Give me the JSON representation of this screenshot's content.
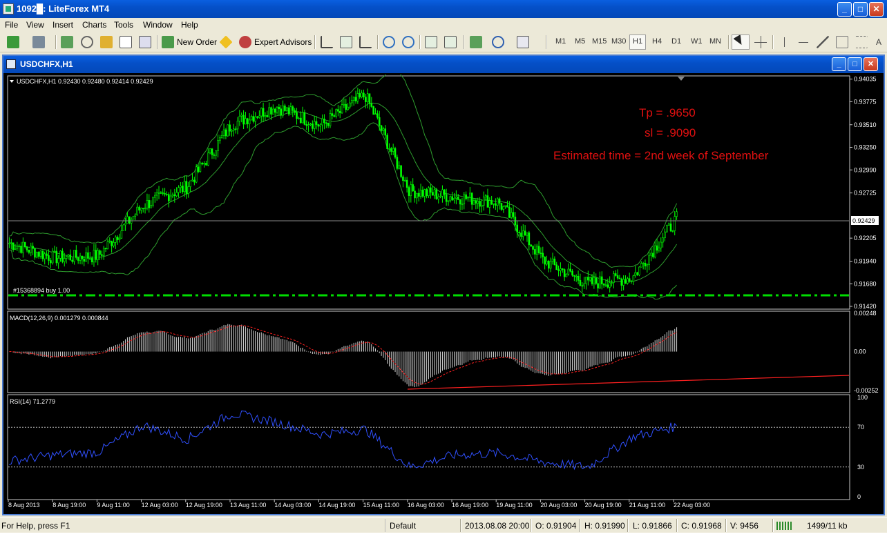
{
  "window": {
    "title": "1092█: LiteForex MT4"
  },
  "menu": [
    "File",
    "View",
    "Insert",
    "Charts",
    "Tools",
    "Window",
    "Help"
  ],
  "toolbar": {
    "new_order_label": "New Order",
    "expert_advisors_label": "Expert Advisors",
    "timeframes": [
      "M1",
      "M5",
      "M15",
      "M30",
      "H1",
      "H4",
      "D1",
      "W1",
      "MN"
    ],
    "active_timeframe": "H1"
  },
  "chart_window": {
    "title": "USDCHFX,H1",
    "symbol_info": "USDCHFX,H1  0.92430 0.92480 0.92414 0.92429",
    "order_label": "#15368894 buy 1.00",
    "annotations": [
      "Tp = .9650",
      "sl = .9090",
      "Estimated time = 2nd week of September"
    ],
    "current_price": "0.92429",
    "macd_label": "MACD(12,26,9) 0.001279 0.000844",
    "rsi_label": "RSI(14) 71.2779",
    "colors": {
      "candles": "#00ff00",
      "bollinger": "#2e9e2e",
      "annotation": "#e01010",
      "macd_signal": "#ff2020",
      "rsi_line": "#3050ff",
      "order_line": "#00dd00"
    }
  },
  "chart_data": {
    "type": "line",
    "title": "USDCHFX,H1",
    "x": [
      "8 Aug 2013",
      "8 Aug 19:00",
      "9 Aug 11:00",
      "12 Aug 03:00",
      "12 Aug 19:00",
      "13 Aug 11:00",
      "14 Aug 03:00",
      "14 Aug 19:00",
      "15 Aug 11:00",
      "16 Aug 03:00",
      "16 Aug 19:00",
      "19 Aug 11:00",
      "20 Aug 03:00",
      "20 Aug 19:00",
      "21 Aug 11:00",
      "22 Aug 03:00"
    ],
    "price_ticks": [
      "0.94035",
      "0.93775",
      "0.93510",
      "0.93250",
      "0.92990",
      "0.92725",
      "0.92205",
      "0.91940",
      "0.91680",
      "0.91420"
    ],
    "price_range": [
      0.9142,
      0.9404
    ],
    "series": [
      {
        "name": "USDCHFX,H1",
        "values": [
          0.9215,
          0.9198,
          0.92,
          0.9258,
          0.928,
          0.9352,
          0.9372,
          0.935,
          0.9385,
          0.9275,
          0.9268,
          0.9262,
          0.9195,
          0.9168,
          0.9175,
          0.9243
        ]
      }
    ],
    "macd": {
      "label": "MACD(12,26,9) 0.001279 0.000844",
      "ticks": [
        "0.00248",
        "0.00",
        "-0.00252"
      ],
      "range": [
        -0.00252,
        0.00248
      ]
    },
    "rsi": {
      "label": "RSI(14) 71.2779",
      "ticks": [
        "100",
        "70",
        "30",
        "0"
      ],
      "levels": [
        70,
        30
      ],
      "values": [
        36,
        42,
        45,
        72,
        58,
        84,
        75,
        63,
        68,
        30,
        42,
        44,
        35,
        30,
        60,
        71
      ]
    }
  },
  "status": {
    "help": "For Help, press F1",
    "profile": "Default",
    "datetime": "2013.08.08 20:00",
    "open": "O: 0.91904",
    "high": "H: 0.91990",
    "low": "L: 0.91866",
    "close": "C: 0.91968",
    "volume": "V: 9456",
    "traffic": "1499/11 kb"
  }
}
